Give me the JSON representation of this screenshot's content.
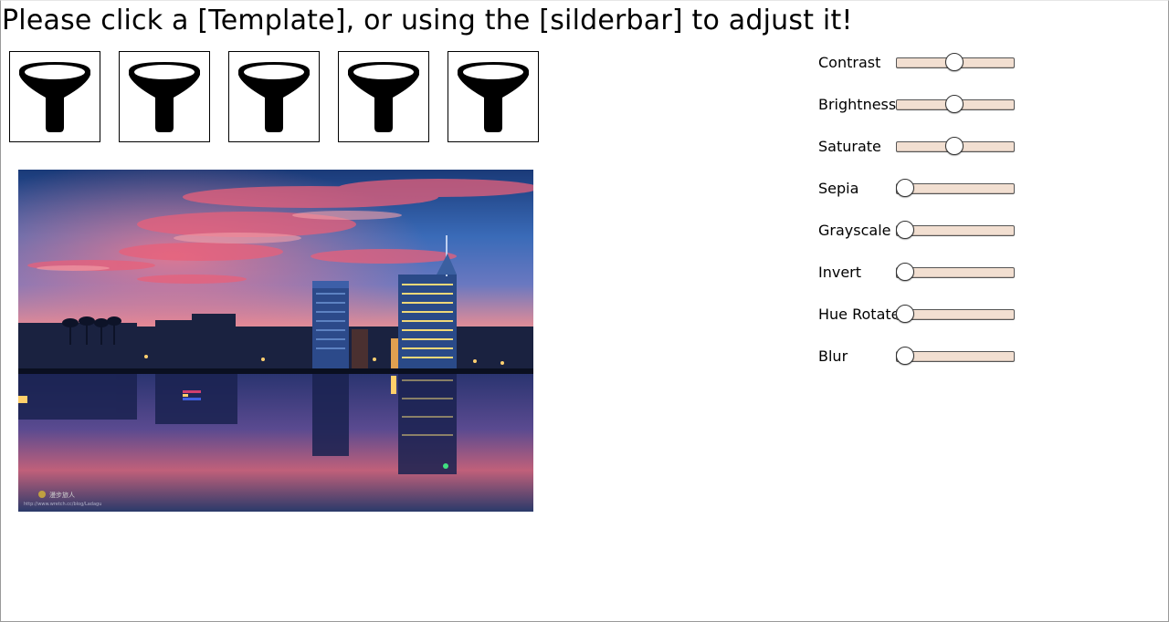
{
  "header": {
    "title": "Please click a [Template], or using the [silderbar] to adjust it!"
  },
  "templates": [
    {
      "icon": "funnel-icon"
    },
    {
      "icon": "funnel-icon"
    },
    {
      "icon": "funnel-icon"
    },
    {
      "icon": "funnel-icon"
    },
    {
      "icon": "funnel-icon"
    }
  ],
  "photo": {
    "watermark": "漫步旅人",
    "watermark_url": "http://www.wretch.cc/blog/Ladagu"
  },
  "sliders": [
    {
      "label": "Contrast",
      "value": 0.5
    },
    {
      "label": "Brightness",
      "value": 0.5
    },
    {
      "label": "Saturate",
      "value": 0.5
    },
    {
      "label": "Sepia",
      "value": 0
    },
    {
      "label": "Grayscale",
      "value": 0
    },
    {
      "label": "Invert",
      "value": 0
    },
    {
      "label": "Hue Rotate",
      "value": 0
    },
    {
      "label": "Blur",
      "value": 0
    }
  ],
  "colors": {
    "track": "#f2dfd1",
    "sky_top": "#1d3f7e",
    "sky_glow": "#e0607a"
  }
}
